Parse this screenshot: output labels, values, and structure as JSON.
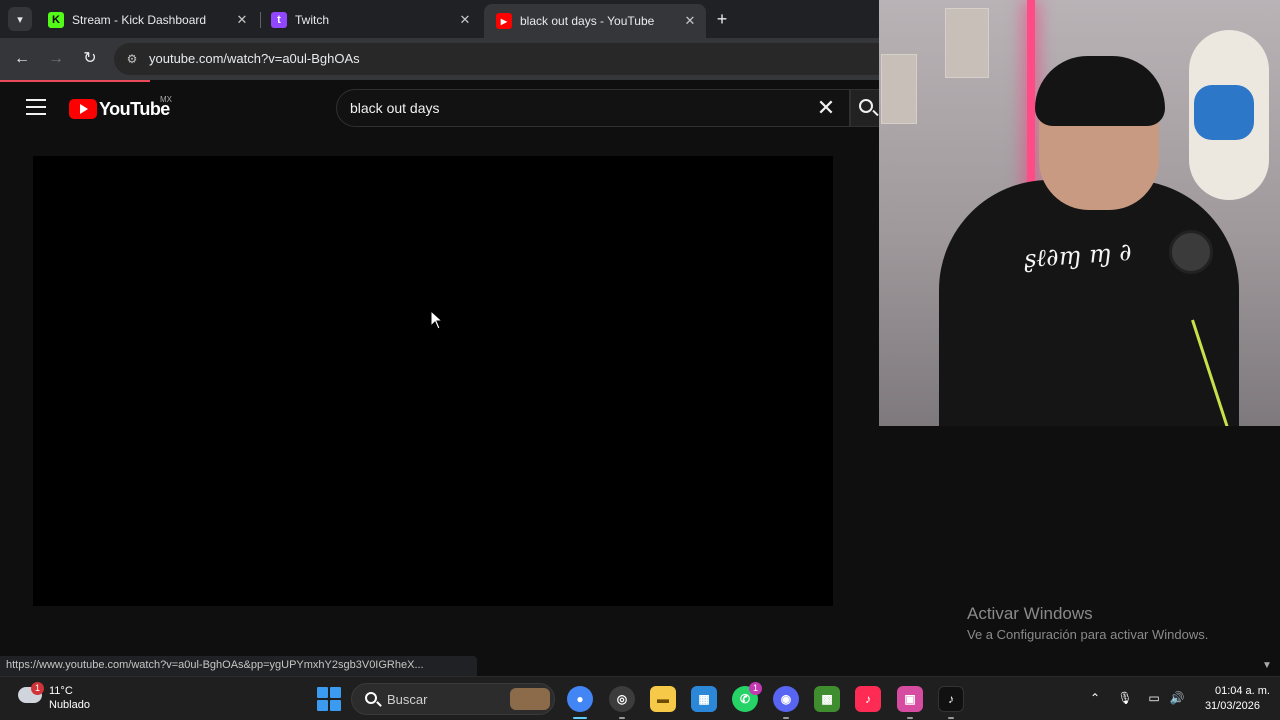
{
  "browser": {
    "tabs": [
      {
        "title": "Stream - Kick Dashboard",
        "icon": "kick-icon",
        "color": "#53fc18"
      },
      {
        "title": "Twitch",
        "icon": "twitch-icon",
        "color": "#9146ff"
      },
      {
        "title": "black out days - YouTube",
        "icon": "youtube-icon",
        "color": "#ff0000",
        "active": true
      }
    ],
    "url": "youtube.com/watch?v=a0ul-BghOAs",
    "status_url": "https://www.youtube.com/watch?v=a0ul-BghOAs&pp=ygUPYmxhY2sgb3V0IGRheX..."
  },
  "youtube": {
    "logo_text": "YouTube",
    "country_code": "MX",
    "search_query": "black out days"
  },
  "webcam": {
    "hoodie_print": "ʂℓ∂ɱ ɱ ∂"
  },
  "watermark": {
    "title": "Activar Windows",
    "subtitle": "Ve a Configuración para activar Windows."
  },
  "taskbar": {
    "weather_badge": "1",
    "temperature": "11°C",
    "condition": "Nublado",
    "search_label": "Buscar",
    "apps": [
      {
        "name": "chrome-icon",
        "color": "#4285f4"
      },
      {
        "name": "obs-icon",
        "color": "#3c3c3c"
      },
      {
        "name": "file-explorer-icon",
        "color": "#f7c948"
      },
      {
        "name": "microsoft-store-icon",
        "color": "#2b88d8"
      },
      {
        "name": "whatsapp-icon",
        "color": "#25d366"
      },
      {
        "name": "discord-icon",
        "color": "#5865f2"
      },
      {
        "name": "minecraft-icon",
        "color": "#3f8d2f"
      },
      {
        "name": "tiktok-live-icon",
        "color": "#fe2c55"
      },
      {
        "name": "app-icon",
        "color": "#d64ca0"
      },
      {
        "name": "tiktok-icon",
        "color": "#111111"
      }
    ],
    "whatsapp_badge": "1",
    "time": "01:04 a. m.",
    "date": "31/03/2026"
  }
}
